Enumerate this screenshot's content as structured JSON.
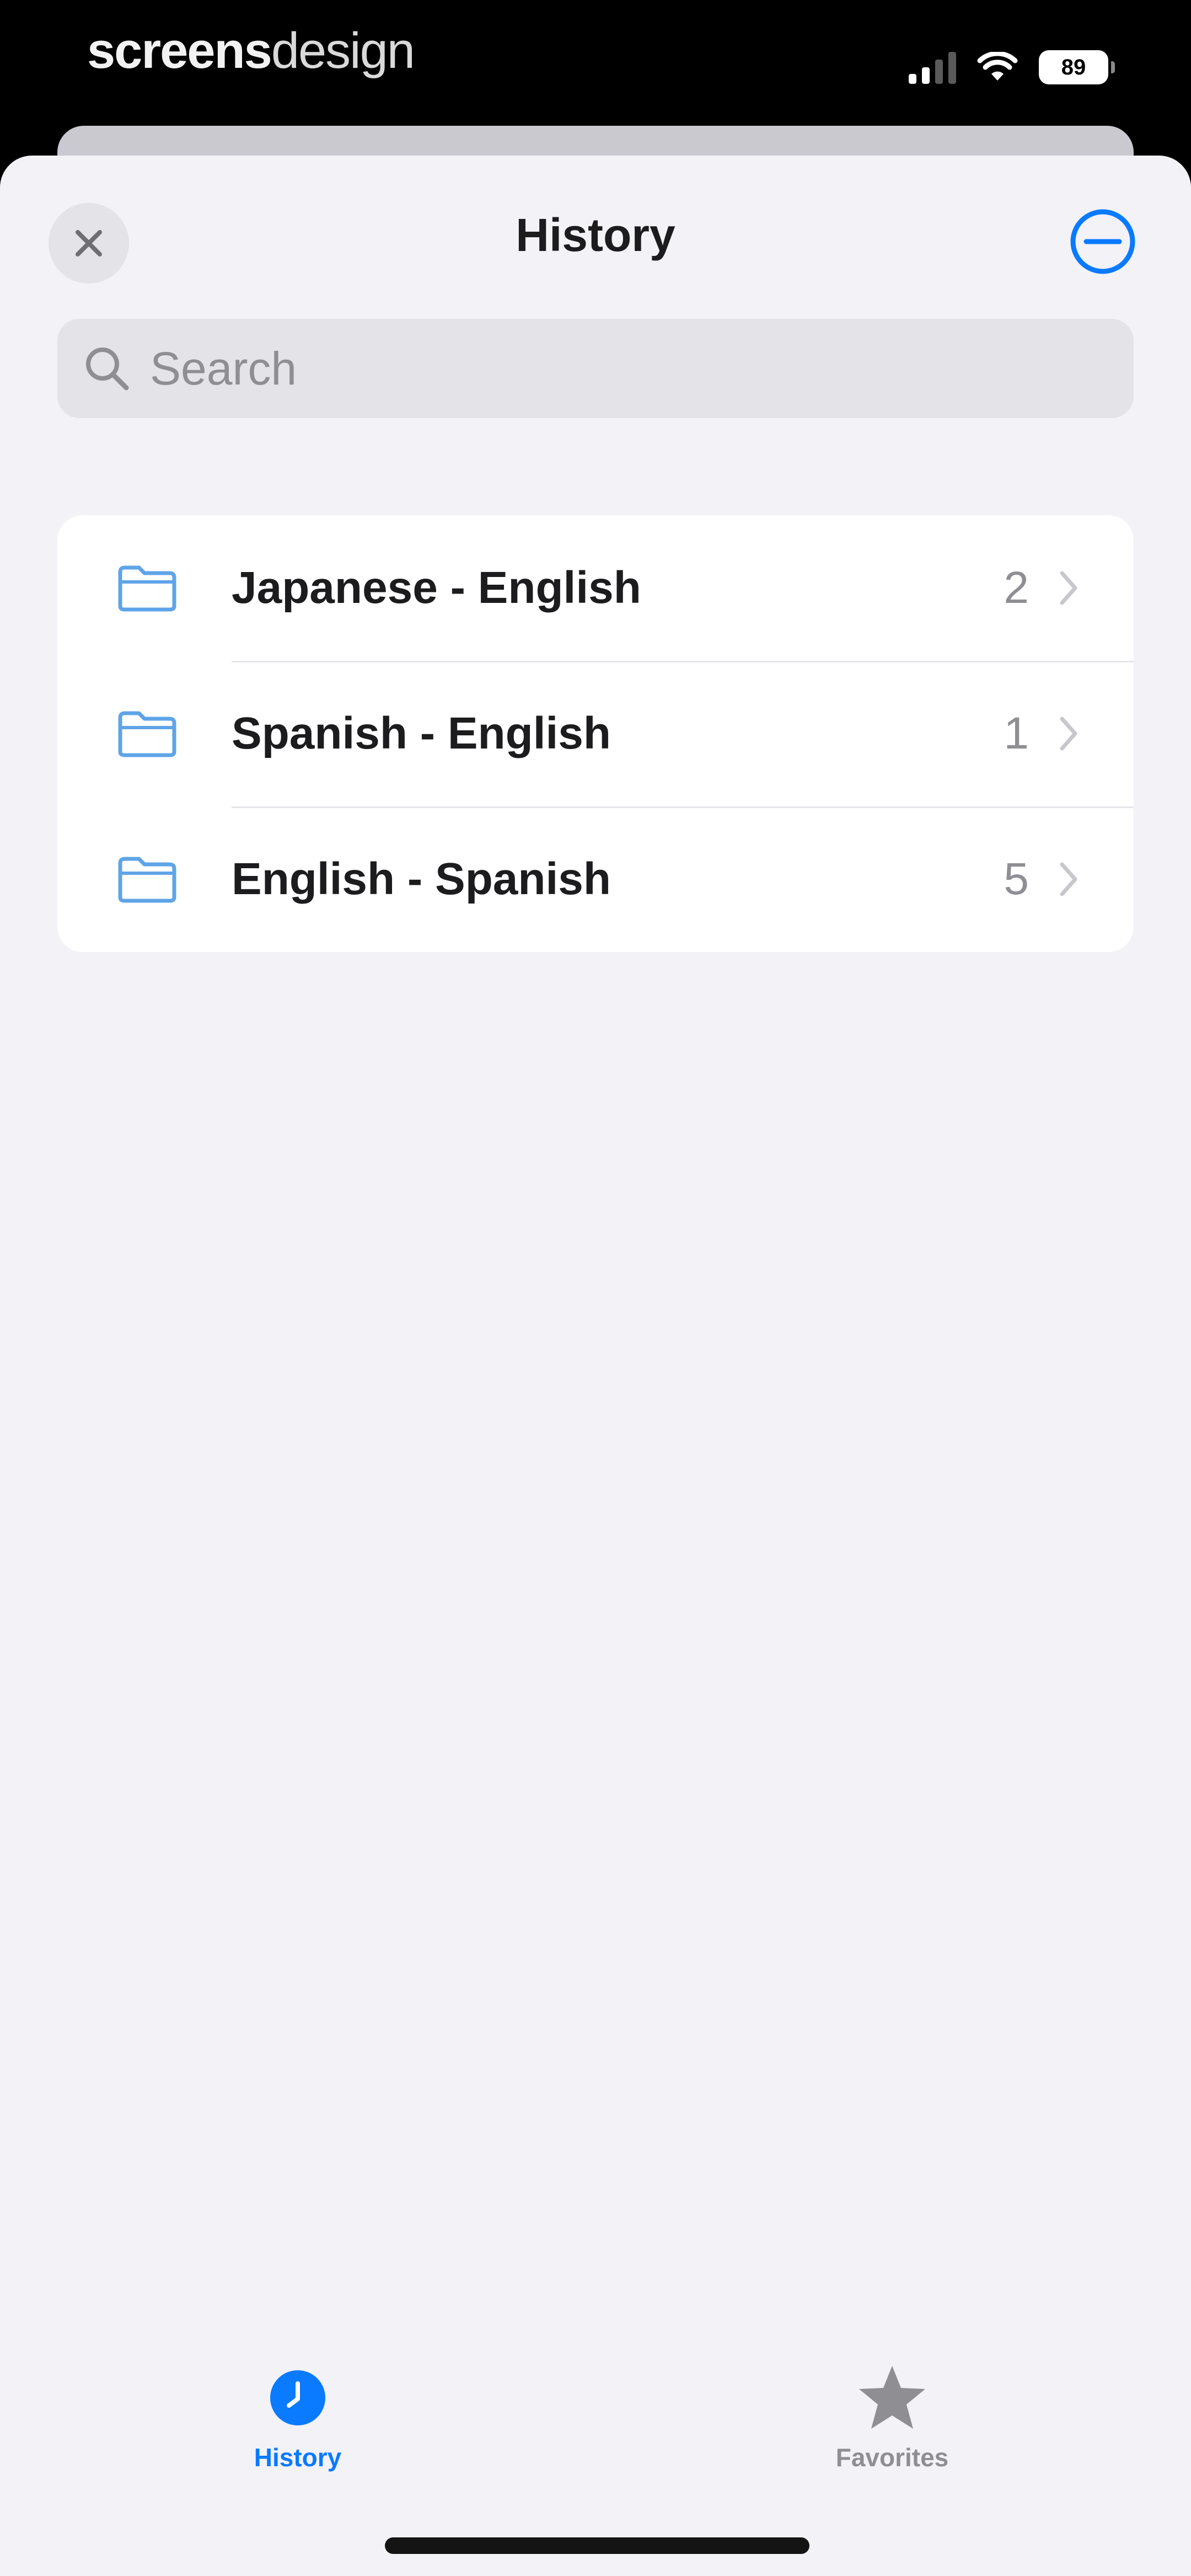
{
  "status_bar": {
    "brand_bold": "screens",
    "brand_light": "design",
    "battery": "89"
  },
  "nav": {
    "title": "History",
    "close_icon": "close-icon",
    "more_icon": "minus-circle-icon"
  },
  "search": {
    "placeholder": "Search",
    "value": ""
  },
  "folders": [
    {
      "label": "Japanese - English",
      "count": "2",
      "icon": "folder-icon"
    },
    {
      "label": "Spanish - English",
      "count": "1",
      "icon": "folder-icon"
    },
    {
      "label": "English - Spanish",
      "count": "5",
      "icon": "folder-icon"
    }
  ],
  "tab_bar": {
    "history_label": "History",
    "favorites_label": "Favorites",
    "active": "History"
  },
  "colors": {
    "accent": "#0a7aff",
    "folder_icon": "#5fa4e8",
    "background": "#f2f2f7",
    "card": "#ffffff",
    "secondary_text": "#8e8e93"
  }
}
